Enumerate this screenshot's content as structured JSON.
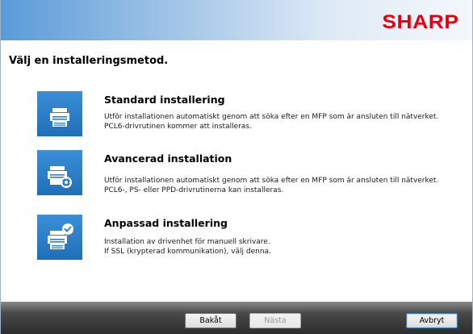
{
  "header": {
    "logo_text": "SHARP",
    "logo_color": "#e60012",
    "gradient_start": "#5a9bd8",
    "gradient_end": "#f4f8fc"
  },
  "page": {
    "title": "Välj en installeringsmetod."
  },
  "options": [
    {
      "icon": "printer-icon",
      "title": "Standard installering",
      "desc_line1": "Utför installationen automatiskt genom att söka efter en MFP som är ansluten till nätverket.",
      "desc_line2": "PCL6-drivrutinen kommer att installeras."
    },
    {
      "icon": "printer-gear-icon",
      "title": "Avancerad installation",
      "desc_line1": "Utför installationen automatiskt genom att söka efter en MFP som är ansluten till nätverket.",
      "desc_line2": "PCL6-, PS- eller PPD-drivrutinerna kan installeras."
    },
    {
      "icon": "printer-check-icon",
      "title": "Anpassad installering",
      "desc_line1": "Installation av drivenhet för manuell skrivare.",
      "desc_line2": "If SSL (krypterad kommunikation), välj denna."
    }
  ],
  "footer": {
    "back_label": "Bakåt",
    "next_label": "Nästa",
    "cancel_label": "Avbryt",
    "next_disabled": true
  },
  "colors": {
    "icon_blue": "#2a7fc9",
    "footer_dark": "#2c2c2c"
  }
}
